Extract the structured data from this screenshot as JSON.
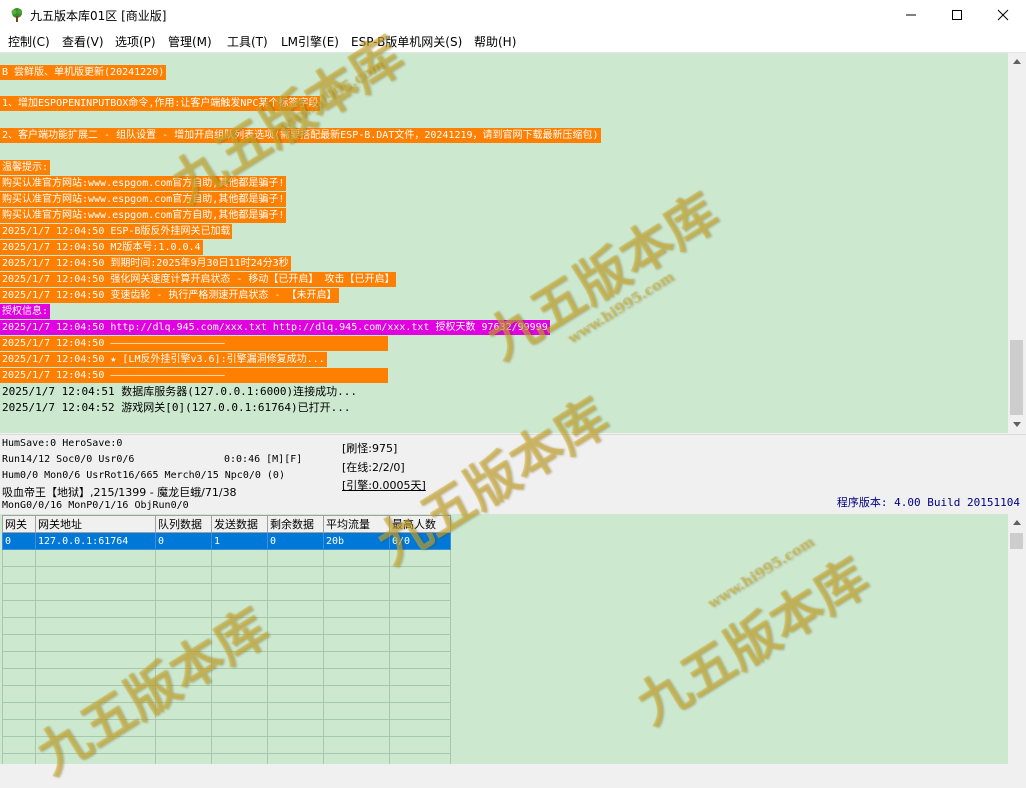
{
  "window": {
    "title": "九五版本库01区 [商业版]",
    "icon": "tree-icon"
  },
  "menu": [
    "控制(C)",
    "查看(V)",
    "选项(P)",
    "管理(M)",
    "工具(T)",
    "LM引擎(E)",
    "ESP-B版单机网关(S)",
    "帮助(H)"
  ],
  "log": {
    "lines": [
      {
        "text": "B 尝鲜版、单机版更新(20241220)",
        "style": "orange"
      },
      {
        "text": "1、增加ESPOPENINPUTBOX命令,作用:让客户端触发NPC某个标签字段",
        "style": "orange"
      },
      {
        "text": "2、客户端功能扩展二 - 组队设置 - 增加开启组队列表选项(需要搭配最新ESP-B.DAT文件，20241219，请到官网下载最新压缩包)",
        "style": "orange"
      },
      {
        "text": "温馨提示:",
        "style": "orange"
      },
      {
        "text": "购买认准官方网站:www.espgom.com官方自助,其他都是骗子!",
        "style": "orange"
      },
      {
        "text": "购买认准官方网站:www.espgom.com官方自助,其他都是骗子!",
        "style": "orange"
      },
      {
        "text": "购买认准官方网站:www.espgom.com官方自助,其他都是骗子!",
        "style": "orange"
      },
      {
        "text": "2025/1/7 12:04:50 ESP-B版反外挂网关已加载",
        "style": "orange"
      },
      {
        "text": "2025/1/7 12:04:50 M2版本号:1.0.0.4",
        "style": "orange"
      },
      {
        "text": "2025/1/7 12:04:50 到期时间:2025年9月30日11时24分3秒",
        "style": "orange"
      },
      {
        "text": "2025/1/7 12:04:50 强化网关速度计算开启状态 - 移动【已开启】 攻击【已开启】",
        "style": "orange"
      },
      {
        "text": "2025/1/7 12:04:50 变速齿轮 - 执行严格测速开启状态 - 【未开启】",
        "style": "orange"
      },
      {
        "text": "授权信息:",
        "style": "magenta"
      },
      {
        "text": "2025/1/7 12:04:50 http://dlq.945.com/xxx.txt http://dlq.945.com/xxx.txt 授权天数 97632/99999",
        "style": "magenta"
      },
      {
        "text": "2025/1/7 12:04:50 ———————————————————",
        "style": "orange"
      },
      {
        "text": "2025/1/7 12:04:50 ★ [LM反外挂引擎v3.6]:引擎漏洞修复成功...",
        "style": "orange"
      },
      {
        "text": "2025/1/7 12:04:50 ———————————————————",
        "style": "orange"
      },
      {
        "text": "2025/1/7 12:04:51 数据库服务器(127.0.0.1:6000)连接成功...",
        "style": "plain"
      },
      {
        "text": "2025/1/7 12:04:52 游戏网关[0](127.0.0.1:61764)已打开...",
        "style": "plain"
      }
    ]
  },
  "status": {
    "line1": "HumSave:0 HeroSave:0",
    "line2": "Run14/12 Soc0/0 Usr0/6",
    "line2b": "0:0:46 [M][F]",
    "line3": "Hum0/0 Mon0/6 UsrRot16/665 Merch0/15 Npc0/0 (0)",
    "line4": "吸血帝王【地狱】,215/1399 - 魔龙巨蛾/71/38",
    "line5": "MonG0/0/16 MonP0/1/16 ObjRun0/0",
    "refresh": "[刷怪:975]",
    "online": "[在线:2/2/0]",
    "engine": "[引擎:0.0005天]",
    "version": "程序版本: 4.00 Build 20151104"
  },
  "grid": {
    "headers": [
      "网关",
      "网关地址",
      "队列数据",
      "发送数据",
      "剩余数据",
      "平均流量",
      "最高人数"
    ],
    "rows": [
      [
        "0",
        "127.0.0.1:61764",
        "0",
        "1",
        "0",
        "20b",
        "0/0"
      ]
    ]
  },
  "watermark": {
    "name": "九五版本库",
    "url": "www.hi995.com"
  },
  "colors": {
    "log_bg": "#cce8cf",
    "highlight_orange": "#ff7f00",
    "highlight_magenta": "#e000e0",
    "selection": "#0078d7"
  }
}
